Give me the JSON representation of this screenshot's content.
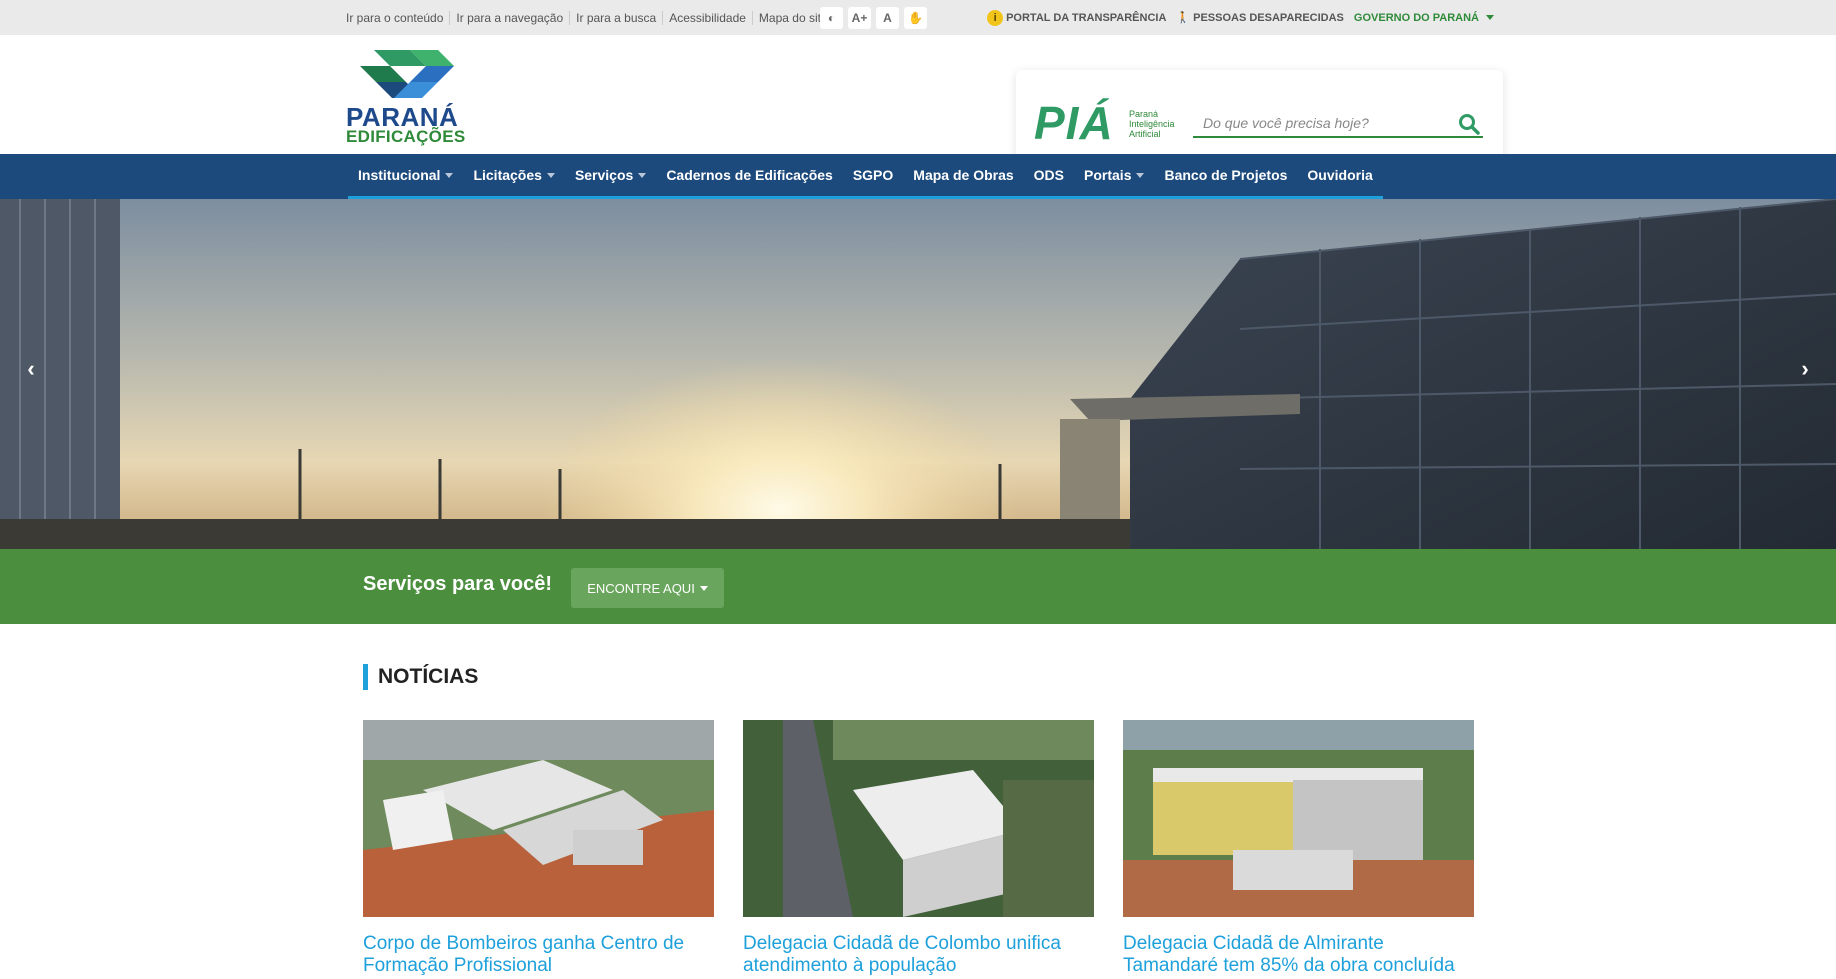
{
  "topbar": {
    "skip_links": [
      "Ir para o conteúdo",
      "Ir para a navegação",
      "Ir para a busca",
      "Acessibilidade",
      "Mapa do site"
    ],
    "access_buttons": [
      "◐",
      "A+",
      "A",
      "✋"
    ],
    "transparency": "PORTAL DA TRANSPARÊNCIA",
    "missing": "PESSOAS DESAPARECIDAS",
    "gov": "GOVERNO DO PARANÁ"
  },
  "header": {
    "logo_line1": "PARANÁ",
    "logo_line2": "EDIFICAÇÕES",
    "pia": "PIÁ",
    "pia_sub": [
      "Paraná",
      "Inteligência",
      "Artificial"
    ],
    "search_placeholder": "Do que você precisa hoje?"
  },
  "nav": {
    "items": [
      {
        "label": "Institucional",
        "dropdown": true
      },
      {
        "label": "Licitações",
        "dropdown": true
      },
      {
        "label": "Serviços",
        "dropdown": true
      },
      {
        "label": "Cadernos de Edificações",
        "dropdown": false
      },
      {
        "label": "SGPO",
        "dropdown": false
      },
      {
        "label": "Mapa de Obras",
        "dropdown": false
      },
      {
        "label": "ODS",
        "dropdown": false
      },
      {
        "label": "Portais",
        "dropdown": true
      },
      {
        "label": "Banco de Projetos",
        "dropdown": false
      },
      {
        "label": "Ouvidoria",
        "dropdown": false
      }
    ]
  },
  "hero": {
    "prev": "‹",
    "next": "›"
  },
  "services": {
    "title": "Serviços para você!",
    "button": "ENCONTRE AQUI"
  },
  "news": {
    "heading": "NOTÍCIAS",
    "items": [
      {
        "title": "Corpo de Bombeiros ganha Centro de Formação Profissional"
      },
      {
        "title": "Delegacia Cidadã de Colombo unifica atendimento à população"
      },
      {
        "title": "Delegacia Cidadã de Almirante Tamandaré tem 85% da obra concluída"
      }
    ]
  },
  "colors": {
    "nav": "#1d4a7c",
    "accent": "#1ea0db",
    "green": "#4b8f3e",
    "brand_blue": "#1e4a8c"
  }
}
